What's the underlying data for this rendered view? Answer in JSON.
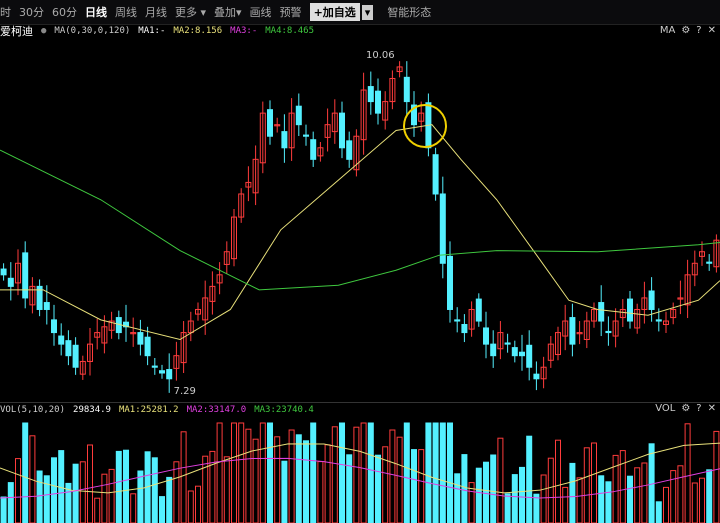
{
  "toolbar": {
    "items": [
      "时",
      "30分",
      "60分",
      "日线",
      "周线",
      "月线",
      "更多 ▾",
      "叠加▾",
      "画线",
      "预警"
    ],
    "active": "日线",
    "add_fav": "+加自选",
    "dropdown": "▾",
    "smart": "智能形态"
  },
  "stock": {
    "name": "爱柯迪"
  },
  "main_ma": {
    "label": "MA(0,30,0,120)",
    "ma1": "MA1:-",
    "ma2": "MA2:8.156",
    "ma3": "MA3:-",
    "ma4": "MA4:8.465",
    "ctrl_label": "MA"
  },
  "vol": {
    "label": "VOL(5,10,20)",
    "value": "29834.9",
    "ma1": "MA1:25281.2",
    "ma2": "MA2:33147.0",
    "ma3": "MA3:23740.4",
    "ctrl_label": "VOL"
  },
  "icons": {
    "settings": "⚙",
    "help": "?",
    "close": "✕"
  },
  "colors": {
    "up": "#ff3c3c",
    "down": "#54f0ff",
    "ma30": "#e8e07a",
    "ma120": "#3fc83f",
    "ma2": "#e040e0"
  },
  "chart_data": {
    "type": "candlestick",
    "high_label": "10.06",
    "low_label": "7.29",
    "price_range": [
      7.1,
      10.3
    ],
    "closes": [
      8.2,
      8.1,
      8.3,
      8.0,
      8.1,
      7.9,
      7.9,
      7.7,
      7.6,
      7.5,
      7.4,
      7.45,
      7.6,
      7.7,
      7.75,
      7.8,
      7.7,
      7.75,
      7.7,
      7.6,
      7.5,
      7.4,
      7.35,
      7.3,
      7.5,
      7.7,
      7.8,
      7.9,
      8.0,
      8.1,
      8.2,
      8.4,
      8.7,
      8.9,
      9.0,
      9.2,
      9.6,
      9.4,
      9.5,
      9.3,
      9.6,
      9.5,
      9.4,
      9.2,
      9.3,
      9.5,
      9.6,
      9.3,
      9.2,
      9.4,
      9.8,
      9.7,
      9.6,
      9.7,
      9.9,
      10.0,
      9.7,
      9.5,
      9.6,
      9.3,
      8.9,
      8.3,
      7.9,
      7.8,
      7.7,
      7.9,
      7.8,
      7.6,
      7.5,
      7.7,
      7.6,
      7.5,
      7.5,
      7.4,
      7.3,
      7.4,
      7.6,
      7.7,
      7.8,
      7.6,
      7.7,
      7.8,
      7.9,
      7.8,
      7.7,
      7.8,
      7.9,
      7.8,
      7.9,
      8.0,
      7.9,
      7.8,
      7.8,
      7.9,
      8.0,
      8.2,
      8.3,
      8.4,
      8.3,
      8.5
    ],
    "ma30": [
      [
        0,
        8.07
      ],
      [
        6,
        8.07
      ],
      [
        14,
        7.81
      ],
      [
        25,
        7.64
      ],
      [
        32,
        7.9
      ],
      [
        39,
        8.59
      ],
      [
        47,
        9.02
      ],
      [
        55,
        9.45
      ],
      [
        60,
        9.5
      ],
      [
        64,
        9.2
      ],
      [
        69,
        8.85
      ],
      [
        75,
        8.33
      ],
      [
        79,
        7.98
      ],
      [
        83,
        7.9
      ],
      [
        90,
        7.85
      ],
      [
        97,
        7.98
      ],
      [
        100,
        8.15
      ]
    ],
    "ma120": [
      [
        0,
        9.28
      ],
      [
        14,
        8.85
      ],
      [
        25,
        8.41
      ],
      [
        36,
        8.07
      ],
      [
        47,
        8.11
      ],
      [
        55,
        8.24
      ],
      [
        61,
        8.37
      ],
      [
        69,
        8.41
      ],
      [
        83,
        8.4
      ],
      [
        97,
        8.46
      ],
      [
        100,
        8.48
      ]
    ]
  }
}
